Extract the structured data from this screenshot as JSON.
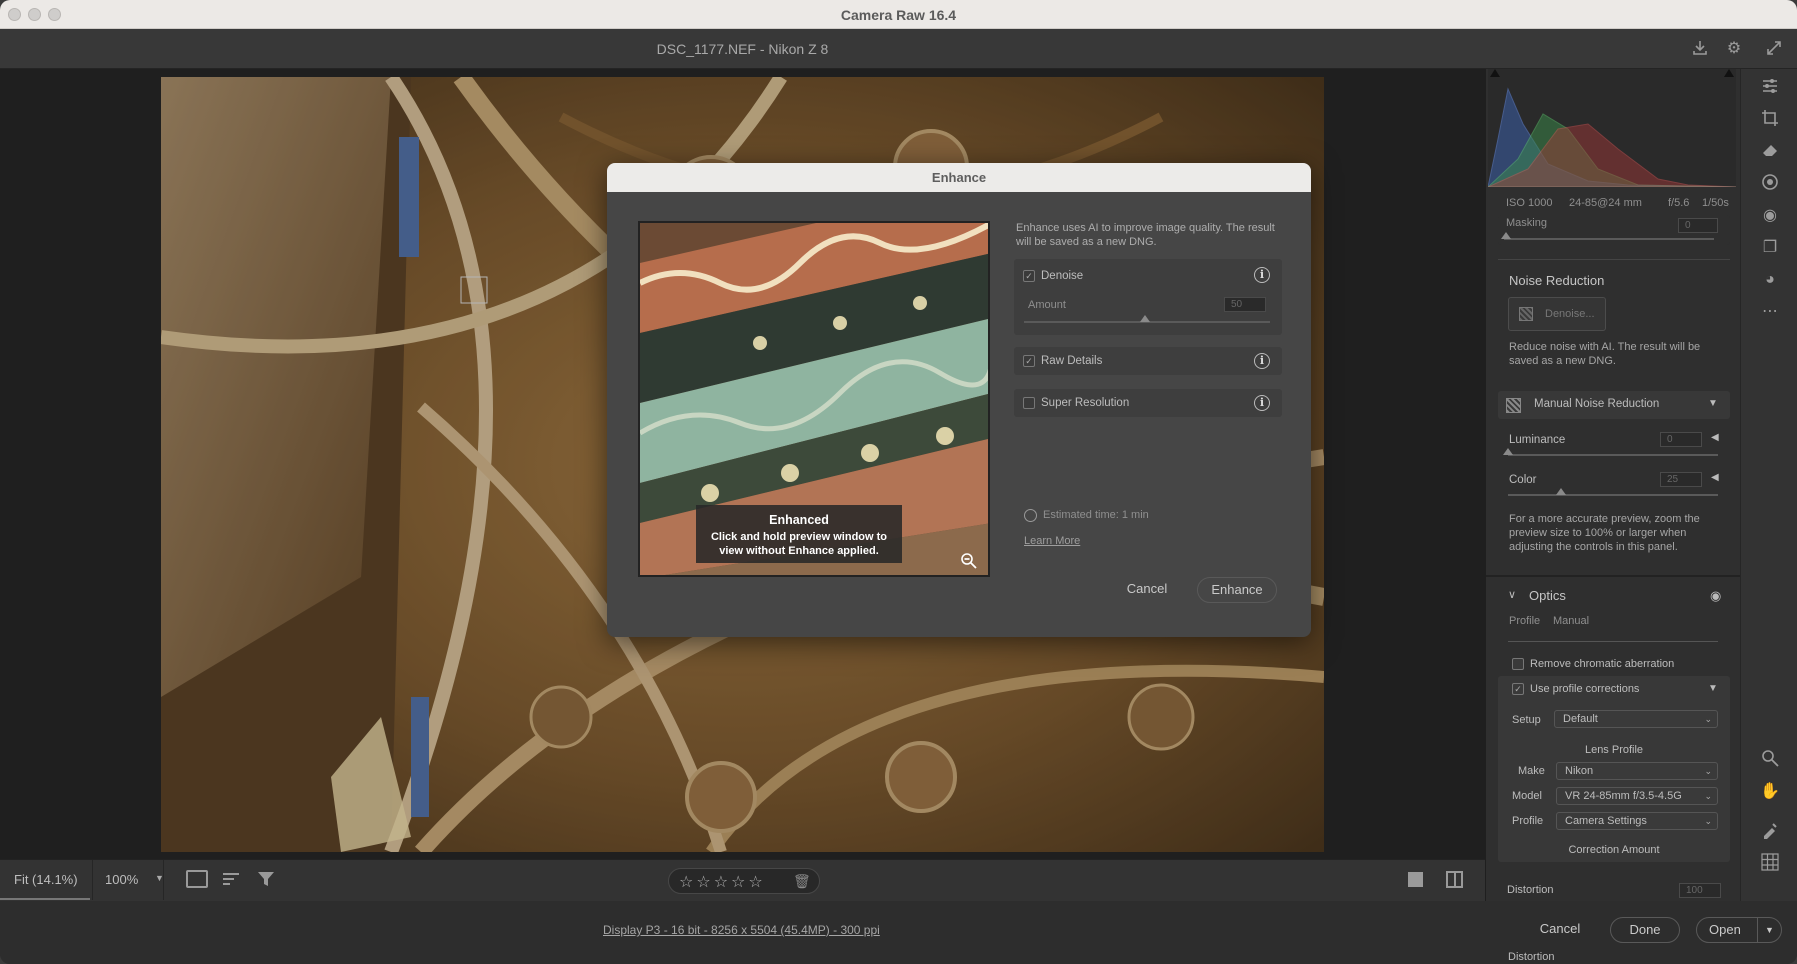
{
  "window": {
    "title": "Camera Raw 16.4"
  },
  "topbar": {
    "file_title": "DSC_1177.NEF  -  Nikon Z 8"
  },
  "filmstrip": {
    "zoom_fit": "Fit (14.1%)",
    "zoom_level": "100%",
    "rating_stars": 5
  },
  "status": {
    "file_info": "Display P3 - 16 bit - 8256 x 5504 (45.4MP) - 300 ppi",
    "cancel": "Cancel",
    "done": "Done",
    "open": "Open"
  },
  "histogram": {
    "iso": "ISO 1000",
    "lens": "24-85@24 mm",
    "aperture": "f/5.6",
    "shutter": "1/50s"
  },
  "panel": {
    "masking_label": "Masking",
    "masking_value": "0",
    "noise_title": "Noise Reduction",
    "denoise_button": "Denoise...",
    "noise_desc": "Reduce noise with AI. The result will be saved as a new DNG.",
    "manual_nr": "Manual Noise Reduction",
    "luminance_label": "Luminance",
    "luminance_value": "0",
    "color_label": "Color",
    "color_value": "25",
    "preview_hint": "For a more accurate preview, zoom the preview size to 100% or larger when adjusting the controls in this panel.",
    "optics_title": "Optics",
    "tab_profile": "Profile",
    "tab_manual": "Manual",
    "chromatic": "Remove chromatic aberration",
    "profile_corrections": "Use profile corrections",
    "setup_label": "Setup",
    "setup_value": "Default",
    "lens_profile": "Lens Profile",
    "make_label": "Make",
    "make_value": "Nikon",
    "model_label": "Model",
    "model_value": "VR 24-85mm f/3.5-4.5G",
    "profile_label": "Profile",
    "profile_value": "Camera Settings",
    "correction_amount": "Correction Amount",
    "distortion_label": "Distortion",
    "distortion_value": "100"
  },
  "dialog": {
    "title": "Enhance",
    "description": "Enhance uses AI to improve image quality. The result will be saved as a new DNG.",
    "denoise": "Denoise",
    "amount_label": "Amount",
    "amount_value": "50",
    "raw_details": "Raw Details",
    "super_resolution": "Super Resolution",
    "preview_caption_title": "Enhanced",
    "preview_caption_body": "Click and hold preview window to view without Enhance applied.",
    "estimated_time": "Estimated time: 1 min",
    "learn_more": "Learn More",
    "cancel": "Cancel",
    "enhance": "Enhance",
    "info_glyph": "i"
  },
  "colors": {
    "accent": "#1473e6",
    "panel_bg": "#2f2f2f",
    "dialog_bg": "#464646"
  },
  "icons": [
    "save-icon",
    "gear-icon",
    "fullscreen-icon",
    "edit-sliders-icon",
    "crop-icon",
    "eraser-icon",
    "masking-icon",
    "redeye-icon",
    "snapshots-icon",
    "presets-icon",
    "more-icon",
    "zoom-icon",
    "hand-icon",
    "color-sampler-icon",
    "grid-icon",
    "zoom-out-icon",
    "timer-icon",
    "trash-icon",
    "filter-icon",
    "sort-icon"
  ]
}
